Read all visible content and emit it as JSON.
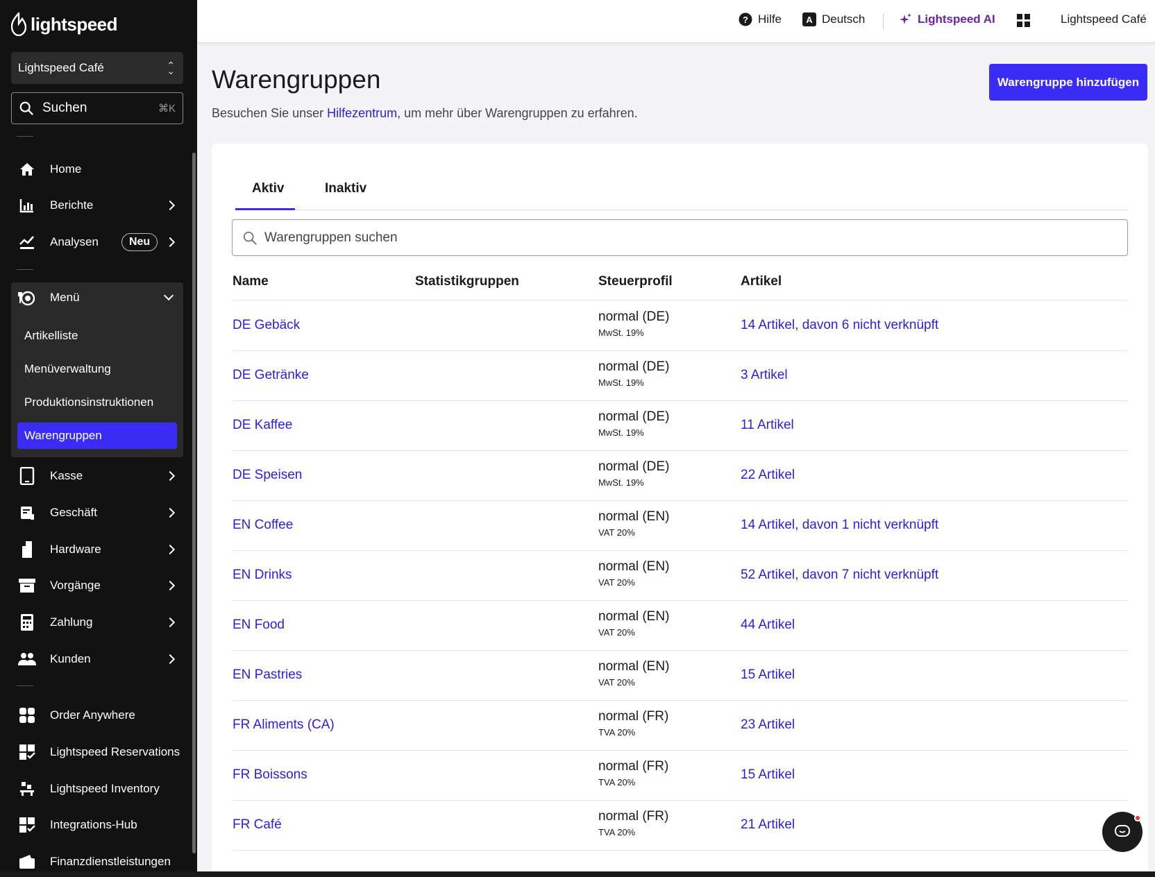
{
  "brand": {
    "logo_text": "lightspeed"
  },
  "sidebar": {
    "store": "Lightspeed Café",
    "search_label": "Suchen",
    "search_shortcut": "⌘K",
    "items_top": [
      {
        "label": "Home",
        "icon": "home-icon"
      },
      {
        "label": "Berichte",
        "icon": "reports-icon"
      },
      {
        "label": "Analysen",
        "icon": "analytics-icon",
        "badge": "Neu"
      }
    ],
    "menu": {
      "label": "Menü",
      "children": [
        "Artikelliste",
        "Menüverwaltung",
        "Produktionsinstruktionen",
        "Warengruppen"
      ],
      "active": "Warengruppen"
    },
    "items_mid": [
      {
        "label": "Kasse",
        "icon": "tablet-icon"
      },
      {
        "label": "Geschäft",
        "icon": "store-icon"
      },
      {
        "label": "Hardware",
        "icon": "hardware-icon"
      },
      {
        "label": "Vorgänge",
        "icon": "archive-icon"
      },
      {
        "label": "Zahlung",
        "icon": "calculator-icon"
      },
      {
        "label": "Kunden",
        "icon": "customers-icon"
      }
    ],
    "items_bottom": [
      {
        "label": "Order Anywhere",
        "icon": "order-anywhere-icon"
      },
      {
        "label": "Lightspeed Reservations",
        "icon": "reservations-icon"
      },
      {
        "label": "Lightspeed Inventory",
        "icon": "inventory-icon"
      },
      {
        "label": "Integrations-Hub",
        "icon": "integrations-icon"
      },
      {
        "label": "Finanzdienstleistungen",
        "icon": "wallet-icon"
      }
    ]
  },
  "topbar": {
    "help": "Hilfe",
    "language": "Deutsch",
    "ai": "Lightspeed AI",
    "account": "Lightspeed Café"
  },
  "page": {
    "title": "Warengruppen",
    "subtitle_pre": "Besuchen Sie unser ",
    "subtitle_link": "Hilfezentrum",
    "subtitle_post": ", um mehr über Warengruppen zu erfahren.",
    "add_button": "Warengruppe hinzufügen"
  },
  "tabs": [
    "Aktiv",
    "Inaktiv"
  ],
  "table": {
    "search_placeholder": "Warengruppen suchen",
    "columns": [
      "Name",
      "Statistikgruppen",
      "Steuerprofil",
      "Artikel"
    ],
    "rows": [
      {
        "name": "DE Gebäck",
        "tax": "normal (DE)",
        "tax_sub": "MwSt. 19%",
        "articles": "14 Artikel, davon 6 nicht verknüpft"
      },
      {
        "name": "DE Getränke",
        "tax": "normal (DE)",
        "tax_sub": "MwSt. 19%",
        "articles": "3 Artikel"
      },
      {
        "name": "DE Kaffee",
        "tax": "normal (DE)",
        "tax_sub": "MwSt. 19%",
        "articles": "11 Artikel"
      },
      {
        "name": "DE Speisen",
        "tax": "normal (DE)",
        "tax_sub": "MwSt. 19%",
        "articles": "22 Artikel"
      },
      {
        "name": "EN Coffee",
        "tax": "normal (EN)",
        "tax_sub": "VAT 20%",
        "articles": "14 Artikel, davon 1 nicht verknüpft"
      },
      {
        "name": "EN Drinks",
        "tax": "normal (EN)",
        "tax_sub": "VAT 20%",
        "articles": "52 Artikel, davon 7 nicht verknüpft"
      },
      {
        "name": "EN Food",
        "tax": "normal (EN)",
        "tax_sub": "VAT 20%",
        "articles": "44 Artikel"
      },
      {
        "name": "EN Pastries",
        "tax": "normal (EN)",
        "tax_sub": "VAT 20%",
        "articles": "15 Artikel"
      },
      {
        "name": "FR Aliments (CA)",
        "tax": "normal (FR)",
        "tax_sub": "TVA 20%",
        "articles": "23 Artikel"
      },
      {
        "name": "FR Boissons",
        "tax": "normal (FR)",
        "tax_sub": "TVA 20%",
        "articles": "15 Artikel"
      },
      {
        "name": "FR Café",
        "tax": "normal (FR)",
        "tax_sub": "TVA 20%",
        "articles": "21 Artikel"
      }
    ]
  },
  "colors": {
    "accent": "#3b2cf5",
    "link": "#2a1ee0",
    "sidebar_bg": "#121212",
    "ai": "#6b21a8"
  }
}
